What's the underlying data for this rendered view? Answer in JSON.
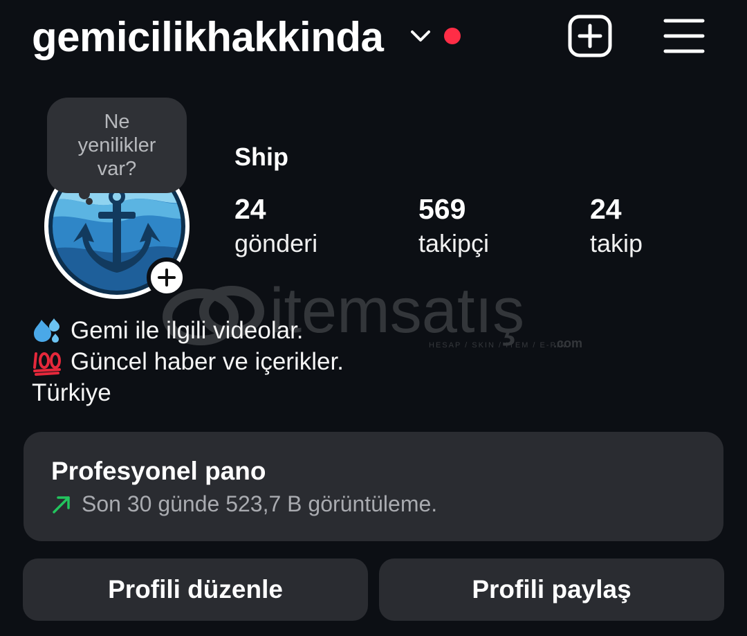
{
  "header": {
    "username": "gemicilikhakkinda",
    "dropdown_icon": "chevron-down-icon",
    "notification_color": "#ff2d46",
    "new_post_icon": "plus-square-icon",
    "menu_icon": "hamburger-menu-icon"
  },
  "profile": {
    "avatar_icon": "anchor-logo",
    "add_story_icon": "plus-icon",
    "note_bubble": [
      "Ne",
      "yenilikler",
      "var?"
    ],
    "display_name": "Ship",
    "stats": [
      {
        "value": "24",
        "label": "gönderi"
      },
      {
        "value": "569",
        "label": "takipçi"
      },
      {
        "value": "24",
        "label": "takip"
      }
    ]
  },
  "watermark": {
    "brand": "itemsatış",
    "tagline": "HESAP / SKIN / ITEM / E-PIN",
    "suffix": ".com"
  },
  "bio": {
    "lines": [
      {
        "emoji": "droplets-emoji",
        "text": "Gemi ile ilgili videolar."
      },
      {
        "emoji": "hundred-points-emoji",
        "text": "Güncel haber ve içerikler."
      },
      {
        "emoji": "",
        "text": "Türkiye"
      }
    ]
  },
  "dashboard": {
    "title": "Profesyonel pano",
    "subtitle": "Son 30 günde 523,7 B görüntüleme.",
    "trend_icon": "trending-up-arrow-icon",
    "trend_color": "#22c55e"
  },
  "actions": {
    "edit_profile": "Profili düzenle",
    "share_profile": "Profili paylaş"
  }
}
